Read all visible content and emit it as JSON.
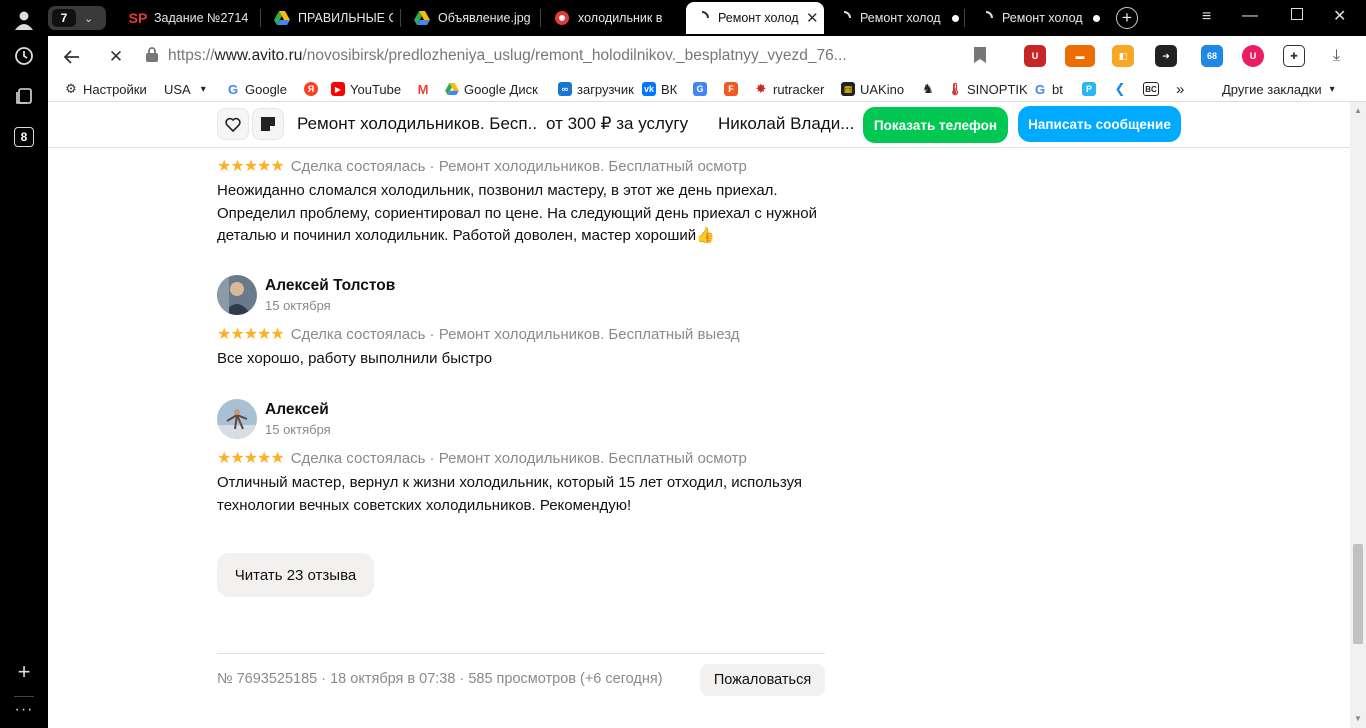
{
  "browser": {
    "tab_count": "7",
    "tabs": [
      {
        "label": "Задание №2714",
        "icon": "SP"
      },
      {
        "label": "ПРАВИЛЬНЫЕ С",
        "icon": "drive"
      },
      {
        "label": "Объявление.jpg",
        "icon": "drive"
      },
      {
        "label": "холодильник в",
        "icon": "record"
      },
      {
        "label": "Ремонт холод",
        "icon": "loading"
      },
      {
        "label": "Ремонт холод",
        "icon": "loading"
      },
      {
        "label": "Ремонт холод",
        "icon": "loading"
      }
    ],
    "url_prefix": "https://",
    "url_domain": "www.avito.ru",
    "url_path": "/novosibirsk/predlozheniya_uslug/remont_holodilnikov._besplatnyy_vyezd_76...",
    "ext_badge_count": "68",
    "bookmarks": [
      {
        "label": "Настройки"
      },
      {
        "label": "USA"
      },
      {
        "label": "Google"
      },
      {
        "label": ""
      },
      {
        "label": "YouTube"
      },
      {
        "label": ""
      },
      {
        "label": "Google Диск"
      },
      {
        "label": "загрузчик"
      },
      {
        "label": "ВК"
      },
      {
        "label": ""
      },
      {
        "label": ""
      },
      {
        "label": "rutracker"
      },
      {
        "label": "UAKino"
      },
      {
        "label": ""
      },
      {
        "label": "SINOPTIK"
      },
      {
        "label": "bt"
      },
      {
        "label": ""
      },
      {
        "label": ""
      },
      {
        "label": ""
      }
    ],
    "more_bookmarks": "»",
    "other_bookmarks": "Другие закладки",
    "rail_badge": "8"
  },
  "sticky_header": {
    "title": "Ремонт холодильников. Бесп...",
    "price": "от 300 ₽ за услугу",
    "seller": "Николай Влади...",
    "show_phone": "Показать телефон",
    "write_message": "Написать сообщение"
  },
  "reviews": [
    {
      "author": "",
      "date": "",
      "stars": "★★★★★",
      "deal": "Сделка состоялась · Ремонт холодильников. Бесплатный осмотр",
      "text": "Неожиданно сломался холодильник, позвонил мастеру, в этот же день приехал. Определил проблему, сориентировал по цене. На следующий день приехал с нужной деталью и починил холодильник. Работой доволен, мастер хороший👍"
    },
    {
      "author": "Алексей Толстов",
      "date": "15 октября",
      "stars": "★★★★★",
      "deal": "Сделка состоялась · Ремонт холодильников. Бесплатный выезд",
      "text": "Все хорошо, работу выполнили быстро"
    },
    {
      "author": "Алексей",
      "date": "15 октября",
      "stars": "★★★★★",
      "deal": "Сделка состоялась · Ремонт холодильников. Бесплатный осмотр",
      "text": "Отличный мастер, вернул к жизни холодильник, который 15 лет отходил, используя технологии вечных советских холодильников. Рекомендую!"
    }
  ],
  "read_more": "Читать 23 отзыва",
  "footer": {
    "info": "№ 7693525185 · 18 октября в 07:38 · 585 просмотров (+6 сегодня)",
    "report": "Пожаловаться"
  },
  "colors": {
    "green": "#00c853",
    "blue": "#00aaff",
    "star": "#ffb021"
  }
}
